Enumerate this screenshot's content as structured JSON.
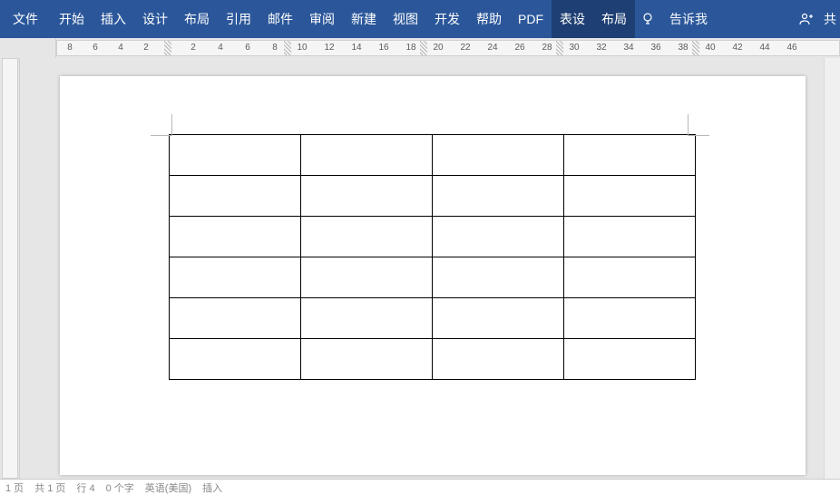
{
  "ribbon": {
    "file": "文件",
    "tabs": [
      "开始",
      "插入",
      "设计",
      "布局",
      "引用",
      "邮件",
      "审阅",
      "新建",
      "视图",
      "开发",
      "帮助",
      "PDF"
    ],
    "context_tabs": [
      "表设",
      "布局"
    ],
    "tell_me": "告诉我",
    "share": "共"
  },
  "ruler": {
    "left_numbers": [
      "8",
      "6",
      "4",
      "2"
    ],
    "right_numbers": [
      "2",
      "4",
      "6",
      "8",
      "10",
      "12",
      "14",
      "16",
      "18",
      "20",
      "22",
      "24",
      "26",
      "28",
      "30",
      "32",
      "34",
      "36",
      "38",
      "40",
      "42",
      "44",
      "46"
    ]
  },
  "document": {
    "table": {
      "rows": 6,
      "cols": 4
    }
  },
  "status": {
    "page": "1 页",
    "total": "共 1 页",
    "line": "行 4",
    "words": "0 个字",
    "lang": "英语(美国)",
    "mode": "插入"
  }
}
